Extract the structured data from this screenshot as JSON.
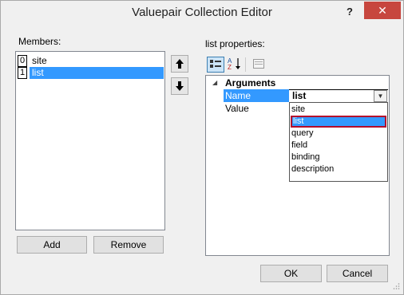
{
  "window": {
    "title": "Valuepair Collection Editor",
    "help": "?",
    "close": "✕"
  },
  "members": {
    "label": "Members:",
    "items": [
      {
        "index": "0",
        "name": "site",
        "selected": false
      },
      {
        "index": "1",
        "name": "list",
        "selected": true
      }
    ],
    "move_up": "🡅",
    "move_down": "🡇",
    "add_label": "Add",
    "remove_label": "Remove"
  },
  "properties": {
    "label": "list properties:",
    "category": "Arguments",
    "rows": [
      {
        "name": "Name",
        "value": "list"
      },
      {
        "name": "Value",
        "value": ""
      }
    ],
    "editor_value": "list",
    "dropdown_options": [
      "site",
      "list",
      "query",
      "field",
      "binding",
      "description"
    ],
    "highlighted_option": "list"
  },
  "footer": {
    "ok_label": "OK",
    "cancel_label": "Cancel"
  },
  "colors": {
    "selection": "#3399ff",
    "highlight_border": "#b40d2c",
    "close_button": "#c7463e"
  }
}
